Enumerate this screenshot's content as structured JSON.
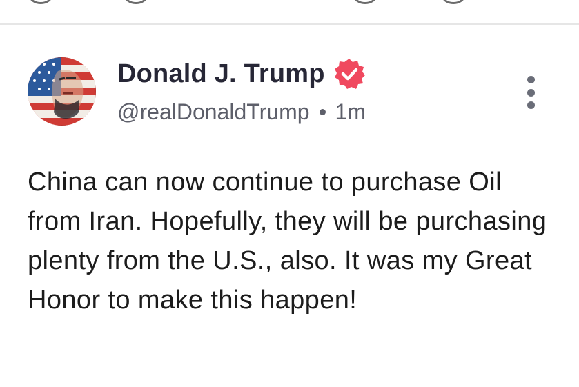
{
  "post": {
    "author": {
      "display_name": "Donald J. Trump",
      "handle": "@realDonaldTrump",
      "verified": true,
      "avatar_icon": "flag-portrait-avatar"
    },
    "time_ago": "1m",
    "text": "China can now continue to purchase Oil from Iran. Hopefully, they will be purchasing plenty from the U.S., also. It was my Great Honor to make this happen!",
    "more_icon": "vertical-ellipsis-icon"
  },
  "colors": {
    "verified_badge": "#f0495f",
    "name_text": "#272736",
    "meta_text": "#5d5f6a",
    "divider": "#e6e6e6"
  }
}
